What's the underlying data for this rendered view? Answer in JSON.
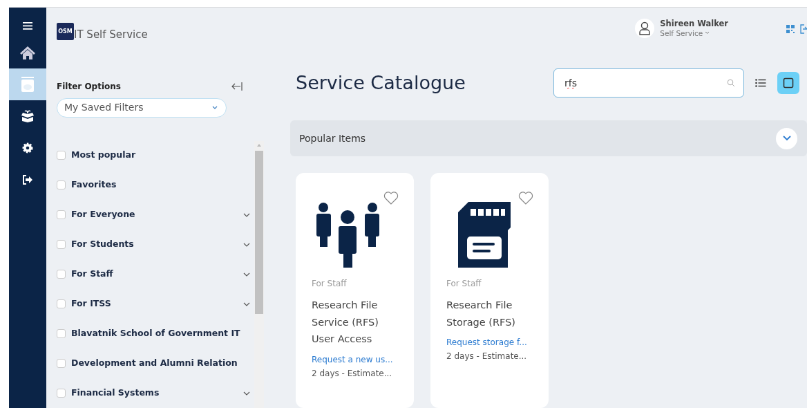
{
  "nav": [
    {
      "kind": "menu",
      "selected": false
    },
    {
      "kind": "home",
      "selected": false
    },
    {
      "kind": "catalogue",
      "selected": true
    },
    {
      "kind": "gift",
      "selected": false
    },
    {
      "kind": "gear",
      "selected": false
    },
    {
      "kind": "logout",
      "selected": false
    }
  ],
  "header": {
    "logo_text": "OSM",
    "app_title": "IT Self Service",
    "user_name": "Shireen Walker",
    "user_role": "Self Service"
  },
  "filters": {
    "title": "Filter Options",
    "saved_filters": "My Saved Filters",
    "items": [
      {
        "label": "Most popular",
        "checked": false,
        "expandable": false
      },
      {
        "label": "Favorites",
        "checked": false,
        "expandable": false
      },
      {
        "label": "For Everyone",
        "checked": false,
        "expandable": true
      },
      {
        "label": "For Students",
        "checked": false,
        "expandable": true
      },
      {
        "label": "For Staff",
        "checked": false,
        "expandable": true
      },
      {
        "label": "For ITSS",
        "checked": false,
        "expandable": true
      },
      {
        "label": "Blavatnik School of Government IT",
        "checked": false,
        "expandable": false
      },
      {
        "label": "Development and Alumni Relation",
        "checked": false,
        "expandable": false
      },
      {
        "label": "Financial Systems",
        "checked": false,
        "expandable": true
      }
    ]
  },
  "catalogue": {
    "title": "Service Catalogue",
    "search": {
      "value": "rfs"
    },
    "views": [
      {
        "kind": "list",
        "selected": false
      },
      {
        "kind": "grid",
        "selected": true
      }
    ],
    "popular": {
      "title": "Popular Items",
      "expanded": false
    },
    "cards": [
      {
        "kind": "people",
        "favorite": false,
        "category": "For Staff",
        "title": "Research File Service (RFS) User Access",
        "description": "Request a new us...",
        "estimate": "2 days - Estimate..."
      },
      {
        "kind": "sd-card",
        "favorite": false,
        "category": "For Staff",
        "title": "Research File Storage (RFS)",
        "description": "Request storage f...",
        "estimate": "2 days - Estimate..."
      }
    ]
  }
}
